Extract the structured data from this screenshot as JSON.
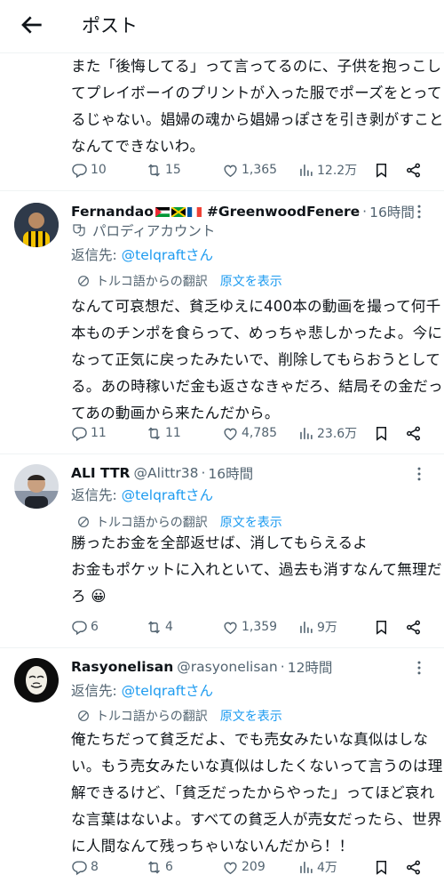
{
  "header": {
    "title": "ポスト"
  },
  "top_post": {
    "lines": [
      "また「後悔してる」って言ってるのに、子供を抱っこし",
      "てプレイボーイのプリントが入った服でポーズをとって",
      "るじゃない。娼婦の魂から娼婦っぽさを引き剥がすこと",
      "なんてできないわ。"
    ],
    "stats": {
      "replies": "10",
      "reposts": "15",
      "likes": "1,365",
      "views": "12.2万"
    }
  },
  "replies": [
    {
      "display_name": "Fernandao",
      "flags": [
        "palestine-flag",
        "jamaica-flag",
        "france-flag"
      ],
      "hashtag": "#GreenwoodFenere",
      "handle": "",
      "time": "16時間",
      "parody_label": "パロディアカウント",
      "reply_to_prefix": "返信先: ",
      "reply_to": "@telqraftさん",
      "translated_from": "トルコ語からの翻訳",
      "show_original": "原文を表示",
      "lines": [
        "なんて可哀想だ、貧乏ゆえに400本の動画を撮って何千",
        "本ものチンポを食らって、めっちゃ悲しかったよ。今に",
        "なって正気に戻ったみたいで、削除してもらおうとして",
        "る。あの時稼いだ金も返さなきゃだろ、結局その金だっ",
        "てあの動画から来たんだから。"
      ],
      "stats": {
        "replies": "11",
        "reposts": "11",
        "likes": "4,785",
        "views": "23.6万"
      }
    },
    {
      "display_name": "ALI TTR",
      "handle": "@Alittr38",
      "time": "16時間",
      "reply_to_prefix": "返信先: ",
      "reply_to": "@telqraftさん",
      "translated_from": "トルコ語からの翻訳",
      "show_original": "原文を表示",
      "lines": [
        "勝ったお金を全部返せば、消してもらえるよ",
        "お金もポケットに入れといて、過去も消すなんて無理だ",
        "ろ 😀"
      ],
      "stats": {
        "replies": "6",
        "reposts": "4",
        "likes": "1,359",
        "views": "9万"
      }
    },
    {
      "display_name": "Rasyonelisan",
      "handle": "@rasyonelisan",
      "time": "12時間",
      "reply_to_prefix": "返信先: ",
      "reply_to": "@telqraftさん",
      "translated_from": "トルコ語からの翻訳",
      "show_original": "原文を表示",
      "lines": [
        "俺たちだって貧乏だよ、でも売女みたいな真似はしな",
        "い。もう売女みたいな真似はしたくないって言うのは理",
        "解できるけど、「貧乏だったからやった」ってほど哀れ",
        "な言葉はないよ。すべての貧乏人が売女だったら、世界",
        "に人間なんて残っちゃいないんだから！！"
      ],
      "stats": {
        "replies": "8",
        "reposts": "6",
        "likes": "209",
        "views": "4万"
      }
    }
  ],
  "colors": {
    "text": "#0f1419",
    "muted": "#536471",
    "link": "#1d9bf0",
    "divider": "#eff3f4"
  }
}
